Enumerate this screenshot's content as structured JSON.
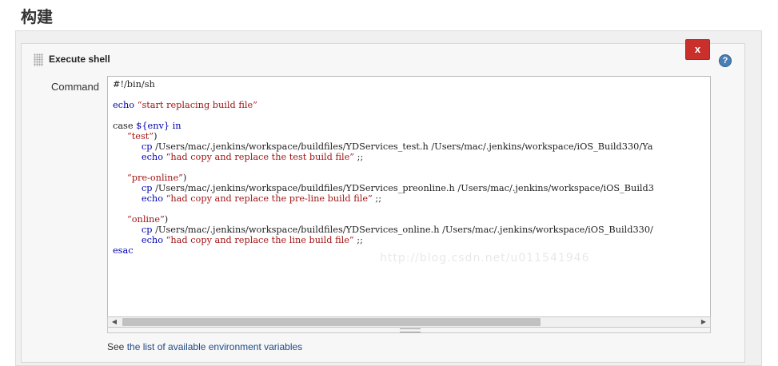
{
  "section": {
    "title": "构建"
  },
  "step": {
    "title": "Execute shell",
    "delete_label": "x",
    "help_label": "?",
    "field_label": "Command"
  },
  "code": {
    "lines": [
      "#!/bin/sh",
      "",
      "echo “start replacing build file”",
      "",
      "case ${env} in",
      "     “test”)",
      "          cp /Users/mac/.jenkins/workspace/buildfiles/YDServices_test.h /Users/mac/.jenkins/workspace/iOS_Build330/Ya",
      "          echo “had copy and replace the test build file” ;;",
      "",
      "     “pre-online”)",
      "          cp /Users/mac/.jenkins/workspace/buildfiles/YDServices_preonline.h /Users/mac/.jenkins/workspace/iOS_Build3",
      "          echo “had copy and replace the pre-line build file” ;;",
      "",
      "     “online”)",
      "          cp /Users/mac/.jenkins/workspace/buildfiles/YDServices_online.h /Users/mac/.jenkins/workspace/iOS_Build330/",
      "          echo “had copy and replace the line build file” ;;",
      "esac"
    ],
    "watermark": "http://blog.csdn.net/u011541946"
  },
  "footer": {
    "prefix": "See",
    "link_text": "the list of available environment variables"
  },
  "colors": {
    "delete_button": "#c9302c",
    "help_icon": "#4a7fb5",
    "keyword": "#0000b0",
    "string": "#a31515"
  }
}
